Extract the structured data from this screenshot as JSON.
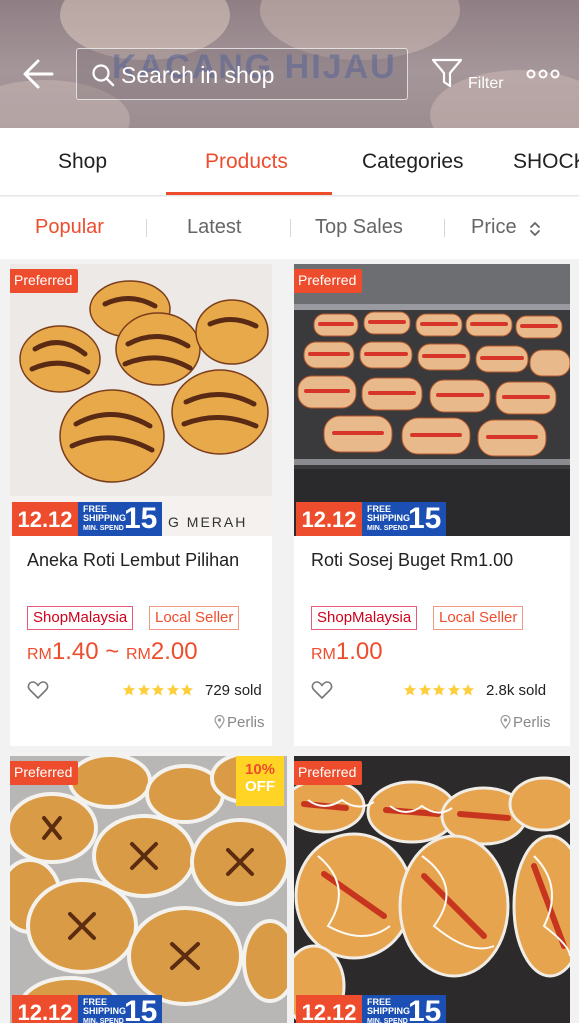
{
  "header": {
    "banner_text": "KACANG HIJAU",
    "search_placeholder": "Search in shop",
    "filter_label": "Filter"
  },
  "tabs": [
    "Shop",
    "Products",
    "Categories",
    "SHOCK"
  ],
  "active_tab": "Products",
  "sort": [
    "Popular",
    "Latest",
    "Top Sales",
    "Price"
  ],
  "active_sort": "Popular",
  "promo": {
    "event": "12.12",
    "free_shipping": "FREE SHIPPING",
    "min_spend": "MIN. SPEND",
    "amount": "15"
  },
  "products": [
    {
      "preferred": "Preferred",
      "image_watermark": "G MERAH",
      "name": "Aneka Roti Lembut Pilihan",
      "tags": [
        "ShopMalaysia",
        "Local Seller"
      ],
      "price_cur1": "RM",
      "price_amt1": "1.40",
      "price_sep": " ~ ",
      "price_cur2": "RM",
      "price_amt2": "2.00",
      "rating_stars": 5,
      "sold": "729 sold",
      "location": "Perlis"
    },
    {
      "preferred": "Preferred",
      "name": "Roti Sosej Buget Rm1.00",
      "tags": [
        "ShopMalaysia",
        "Local Seller"
      ],
      "price_cur1": "RM",
      "price_amt1": "1.00",
      "rating_stars": 5,
      "sold": "2.8k sold",
      "location": "Perlis"
    },
    {
      "preferred": "Preferred",
      "discount_pct": "10%",
      "discount_off": "OFF"
    },
    {
      "preferred": "Preferred"
    }
  ],
  "colors": {
    "accent": "#ee4d2d",
    "promo_blue": "#1b4fb3",
    "discount_yellow": "#ffd424",
    "star": "#ffce3d"
  }
}
